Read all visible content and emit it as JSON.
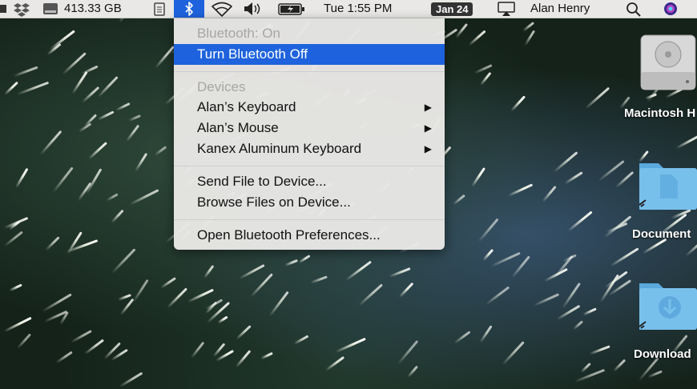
{
  "menubar": {
    "disk_space": "413.33 GB",
    "clock": "Tue 1:55 PM",
    "date": "Jan 24",
    "user_name": "Alan Henry"
  },
  "bluetooth_menu": {
    "status": "Bluetooth: On",
    "toggle": "Turn Bluetooth Off",
    "devices_header": "Devices",
    "devices": [
      "Alan’s Keyboard",
      "Alan’s Mouse",
      "Kanex Aluminum Keyboard"
    ],
    "send_file": "Send File to Device...",
    "browse_files": "Browse Files on Device...",
    "open_prefs": "Open Bluetooth Preferences..."
  },
  "desktop_icons": {
    "disk": "Macintosh H",
    "documents": "Document",
    "downloads": "Download"
  },
  "colors": {
    "highlight": "#1e63dd",
    "folder": "#6cb8e8"
  }
}
